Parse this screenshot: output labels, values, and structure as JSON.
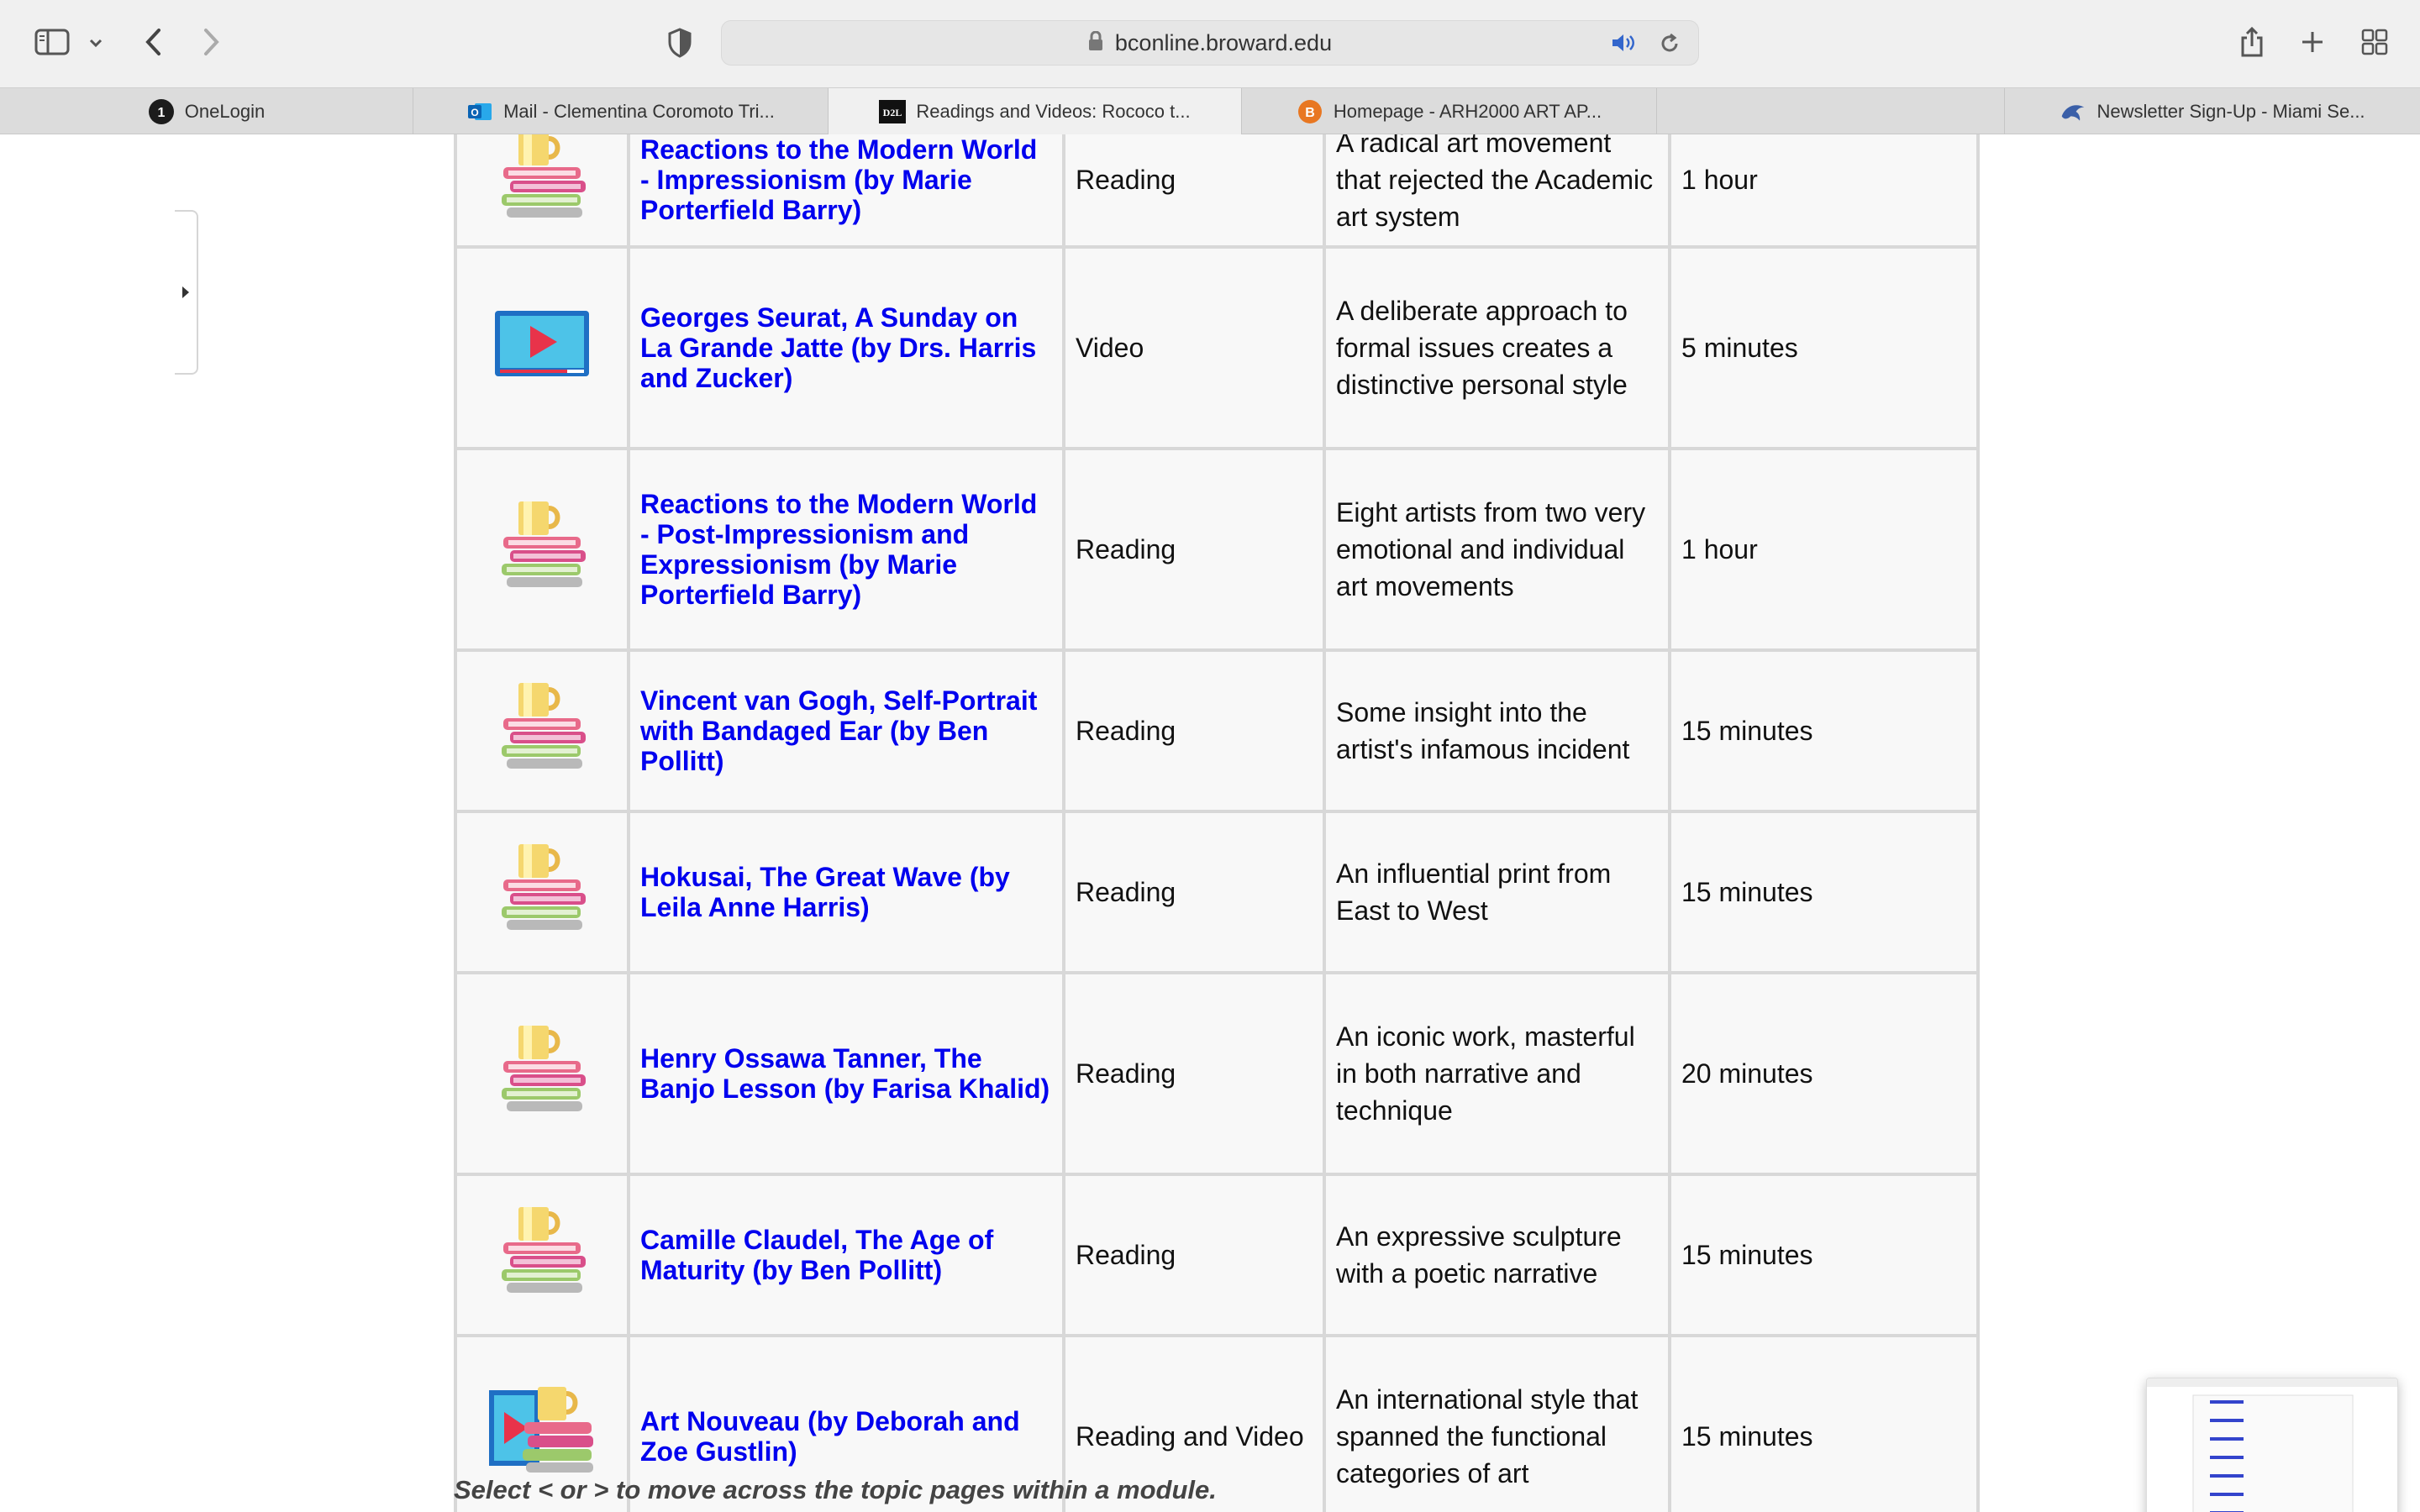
{
  "browser": {
    "url": "bconline.broward.edu",
    "tabs": [
      {
        "label": "OneLogin",
        "icon": "onelogin-icon"
      },
      {
        "label": "Mail - Clementina Coromoto Tri...",
        "icon": "outlook-icon"
      },
      {
        "label": "Readings and Videos: Rococo t...",
        "icon": "d2l-icon"
      },
      {
        "label": "Homepage - ARH2000 ART AP...",
        "icon": "b-logo-icon"
      },
      {
        "label": "",
        "icon": ""
      },
      {
        "label": "Newsletter Sign-Up - Miami Se...",
        "icon": "dolphin-icon"
      }
    ]
  },
  "rows": [
    {
      "title": "Reactions to the Modern World - Impressionism (by Marie Porterfield Barry)",
      "type": "Reading",
      "desc": "A radical art movement that rejected the Academic art system",
      "time": "1 hour",
      "icon": "books-icon"
    },
    {
      "title": "Georges Seurat, A Sunday on La Grande Jatte (by Drs. Harris and Zucker)",
      "type": "Video",
      "desc": "A deliberate approach to formal issues creates a distinctive personal style",
      "time": "5 minutes",
      "icon": "video-icon"
    },
    {
      "title": "Reactions to the Modern World - Post-Impressionism and Expressionism (by Marie Porterfield Barry)",
      "type": "Reading",
      "desc": "Eight artists from two very emotional and individual art movements",
      "time": "1 hour",
      "icon": "books-icon"
    },
    {
      "title": "Vincent van Gogh, Self-Portrait with Bandaged Ear (by Ben Pollitt)",
      "type": "Reading",
      "desc": "Some insight into the artist's infamous incident",
      "time": "15 minutes",
      "icon": "books-icon"
    },
    {
      "title": "Hokusai, The Great Wave (by Leila Anne Harris)",
      "type": "Reading",
      "desc": "An influential print from East to West",
      "time": "15 minutes",
      "icon": "books-icon"
    },
    {
      "title": "Henry Ossawa Tanner, The Banjo Lesson (by Farisa Khalid)",
      "type": "Reading",
      "desc": "An iconic work, masterful in both narrative and technique",
      "time": "20 minutes",
      "icon": "books-icon"
    },
    {
      "title": "Camille Claudel, The Age of Maturity (by Ben Pollitt)",
      "type": "Reading",
      "desc": "An expressive sculpture with a poetic narrative",
      "time": "15 minutes",
      "icon": "books-icon"
    },
    {
      "title": "Art Nouveau (by Deborah and Zoe Gustlin)",
      "type": "Reading and Video",
      "desc": "An international style that spanned the functional categories of art",
      "time": "15 minutes",
      "icon": "books-video-icon"
    }
  ],
  "footer_note": "Select < or > to move across the topic pages within a module."
}
